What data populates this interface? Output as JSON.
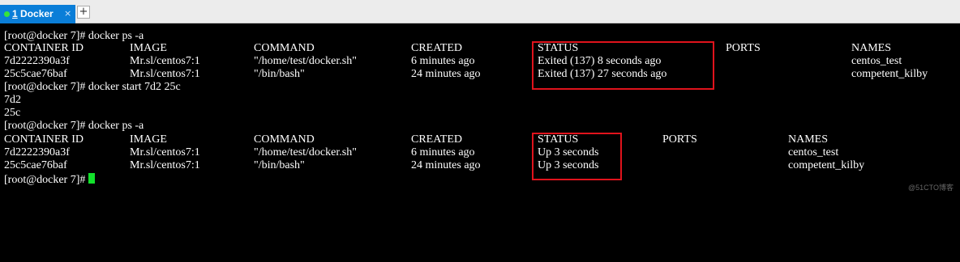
{
  "tab": {
    "number": "1",
    "label": " Docker",
    "close": "×",
    "new_tab": "+"
  },
  "terminal": {
    "cmd1": "[root@docker 7]# docker ps -a",
    "table1": {
      "headers": [
        "CONTAINER ID",
        "IMAGE",
        "COMMAND",
        "CREATED",
        "STATUS",
        "PORTS",
        "NAMES"
      ],
      "rows": [
        [
          "7d2222390a3f",
          "Mr.sl/centos7:1",
          "\"/home/test/docker.sh\"",
          "6 minutes ago",
          "Exited (137) 8 seconds ago",
          "",
          "centos_test"
        ],
        [
          "25c5cae76baf",
          "Mr.sl/centos7:1",
          "\"/bin/bash\"",
          "24 minutes ago",
          "Exited (137) 27 seconds ago",
          "",
          "competent_kilby"
        ]
      ]
    },
    "cmd2": "[root@docker 7]# docker start 7d2 25c",
    "out1": "7d2",
    "out2": "25c",
    "cmd3": "[root@docker 7]# docker ps -a",
    "table2": {
      "headers": [
        "CONTAINER ID",
        "IMAGE",
        "COMMAND",
        "CREATED",
        "STATUS",
        "PORTS",
        "NAMES"
      ],
      "rows": [
        [
          "7d2222390a3f",
          "Mr.sl/centos7:1",
          "\"/home/test/docker.sh\"",
          "6 minutes ago",
          "Up 3 seconds",
          "",
          "centos_test"
        ],
        [
          "25c5cae76baf",
          "Mr.sl/centos7:1",
          "\"/bin/bash\"",
          "24 minutes ago",
          "Up 3 seconds",
          "",
          "competent_kilby"
        ]
      ]
    },
    "prompt": "[root@docker 7]# "
  },
  "watermark": "@51CTO博客",
  "colors": {
    "background": "#000000",
    "text": "#ffffff",
    "tab_active": "#0a7ed8",
    "tab_dot": "#37e33b",
    "cursor": "#12e12b",
    "highlight_box": "#e0131c"
  }
}
